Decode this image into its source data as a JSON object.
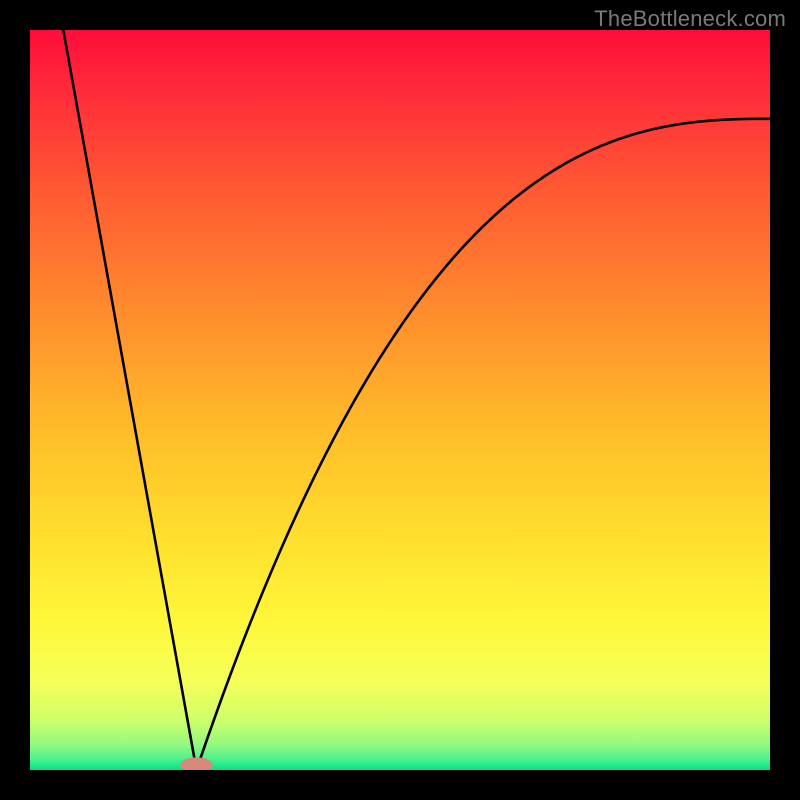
{
  "watermark": "TheBottleneck.com",
  "chart_data": {
    "type": "line",
    "title": "",
    "xlabel": "",
    "ylabel": "",
    "xlim": [
      0,
      1
    ],
    "ylim": [
      0,
      1
    ],
    "background_gradient_stops": [
      {
        "offset": 0.0,
        "color": "#ff0d3a"
      },
      {
        "offset": 0.08,
        "color": "#ff2a3a"
      },
      {
        "offset": 0.22,
        "color": "#ff5a33"
      },
      {
        "offset": 0.38,
        "color": "#ff8c2d"
      },
      {
        "offset": 0.55,
        "color": "#ffbf2a"
      },
      {
        "offset": 0.7,
        "color": "#ffe22e"
      },
      {
        "offset": 0.8,
        "color": "#fff73a"
      },
      {
        "offset": 0.88,
        "color": "#f5ff58"
      },
      {
        "offset": 0.93,
        "color": "#d0ff6a"
      },
      {
        "offset": 0.965,
        "color": "#96f97f"
      },
      {
        "offset": 0.985,
        "color": "#4ef18f"
      },
      {
        "offset": 1.0,
        "color": "#00e385"
      }
    ],
    "curve": {
      "vertex_x": 0.225,
      "left_top_x": 0.045,
      "right_top_x": 1.0,
      "right_top_y": 0.88,
      "stroke": "#000000",
      "stroke_width": 2.6
    },
    "marker": {
      "x": 0.225,
      "y": 0.007,
      "rx": 0.022,
      "ry": 0.01,
      "fill": "#d88a7a"
    }
  }
}
